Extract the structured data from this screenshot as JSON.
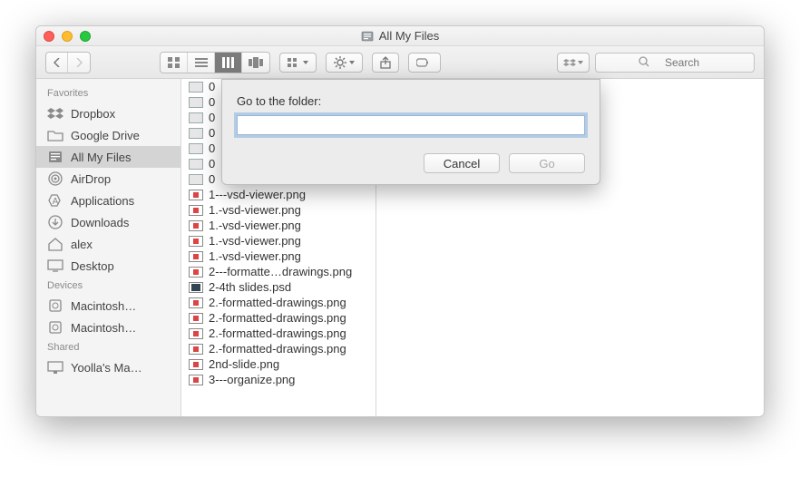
{
  "window": {
    "title": "All My Files"
  },
  "toolbar": {
    "search_placeholder": "Search"
  },
  "sidebar": {
    "sections": [
      {
        "title": "Favorites",
        "items": [
          {
            "label": "Dropbox",
            "icon": "dropbox"
          },
          {
            "label": "Google Drive",
            "icon": "folder"
          },
          {
            "label": "All My Files",
            "icon": "all-files",
            "active": true
          },
          {
            "label": "AirDrop",
            "icon": "airdrop"
          },
          {
            "label": "Applications",
            "icon": "apps"
          },
          {
            "label": "Downloads",
            "icon": "downloads"
          },
          {
            "label": "alex",
            "icon": "home"
          },
          {
            "label": "Desktop",
            "icon": "desktop"
          }
        ]
      },
      {
        "title": "Devices",
        "items": [
          {
            "label": "Macintosh…",
            "icon": "disk"
          },
          {
            "label": "Macintosh…",
            "icon": "disk"
          }
        ]
      },
      {
        "title": "Shared",
        "items": [
          {
            "label": "Yoolla's Ma…",
            "icon": "monitor"
          }
        ]
      }
    ]
  },
  "column": {
    "items": [
      {
        "name": "0",
        "chev": true
      },
      {
        "name": "0",
        "chev": true
      },
      {
        "name": "0",
        "chev": true
      },
      {
        "name": "0",
        "chev": true
      },
      {
        "name": "0",
        "chev": true
      },
      {
        "name": "0",
        "chev": true
      },
      {
        "name": "0",
        "chev": true
      },
      {
        "name": "1---vsd-viewer.png"
      },
      {
        "name": "1.-vsd-viewer.png"
      },
      {
        "name": "1.-vsd-viewer.png"
      },
      {
        "name": "1.-vsd-viewer.png"
      },
      {
        "name": "1.-vsd-viewer.png"
      },
      {
        "name": "2---formatte…drawings.png"
      },
      {
        "name": "2-4th slides.psd",
        "psd": true
      },
      {
        "name": "2.-formatted-drawings.png"
      },
      {
        "name": "2.-formatted-drawings.png"
      },
      {
        "name": "2.-formatted-drawings.png"
      },
      {
        "name": "2.-formatted-drawings.png"
      },
      {
        "name": "2nd-slide.png"
      },
      {
        "name": "3---organize.png"
      }
    ]
  },
  "dialog": {
    "label": "Go to the folder:",
    "value": "",
    "cancel": "Cancel",
    "go": "Go"
  }
}
